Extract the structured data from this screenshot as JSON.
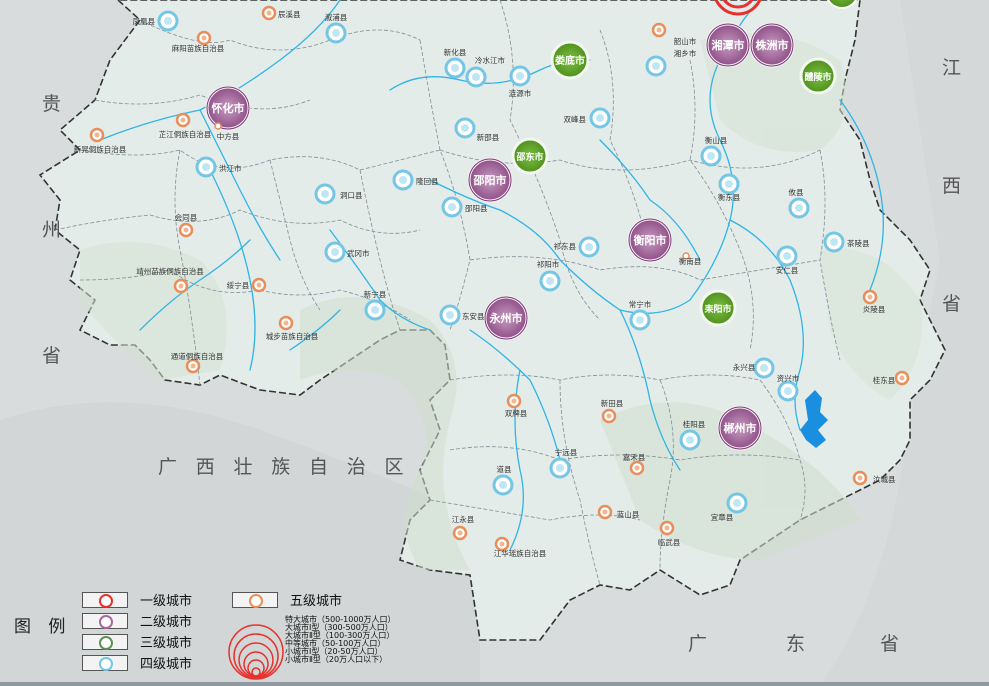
{
  "colors": {
    "land_base": "#e6edec",
    "land_green": "#d7e4d6",
    "outside": "#d9dcdc",
    "river": "#2fb4e6",
    "lake": "#1a8fe0",
    "border_county": "#8a9aa0",
    "border_province": "#333333",
    "level1": "#e8312c",
    "level2": "#a8679e",
    "level3": "#6aaa2c",
    "level4": "#74c6e4",
    "level5": "#e88e5a"
  },
  "regions": {
    "guizhou": [
      "贵",
      "州",
      "省"
    ],
    "guangxi": "广 西 壮 族 自 治 区",
    "jiangxi": [
      "江",
      "西",
      "省"
    ],
    "guangdong": [
      "广",
      "东",
      "省"
    ]
  },
  "cities": {
    "level2": [
      "怀化市",
      "邵阳市",
      "湘潭市",
      "株洲市",
      "衡阳市",
      "永州市",
      "郴州市"
    ],
    "level3": [
      "娄底市",
      "邵东市",
      "醴陵市",
      "耒阳市"
    ],
    "level4": [
      "凤凰县",
      "溆浦县",
      "新化县",
      "冷水江市",
      "涟源市",
      "湘乡市",
      "双峰县",
      "新邵县",
      "洪江市",
      "洞口县",
      "隆回县",
      "邵阳县",
      "衡山县",
      "衡东县",
      "攸县",
      "茶陵县",
      "武冈市",
      "新宁县",
      "祁阳市",
      "东安县",
      "祁东县",
      "常宁市",
      "安仁县",
      "永兴县",
      "资兴市",
      "桂阳县",
      "宁远县",
      "道县",
      "宜章县"
    ],
    "level5": [
      "辰溪县",
      "麻阳苗族自治县",
      "新晃侗族自治县",
      "芷江侗族自治县",
      "中方县",
      "会同县",
      "靖州苗族侗族自治县",
      "绥宁县",
      "城步苗族自治县",
      "通道侗族自治县",
      "韶山市",
      "衡南县",
      "炎陵县",
      "桂东县",
      "双牌县",
      "新田县",
      "嘉禾县",
      "临武县",
      "蓝山县",
      "江永县",
      "江华瑶族自治县",
      "汝城县"
    ]
  },
  "legend": {
    "title": "图 例",
    "items": [
      "一级城市",
      "二级城市",
      "三级城市",
      "四级城市",
      "五级城市"
    ],
    "size_items": [
      "特大城市（500-1000万人口）",
      "大城市Ⅰ型（300-500万人口）",
      "大城市Ⅱ型（100-300万人口）",
      "中等城市（50-100万人口）",
      "小城市Ⅰ型（20-50万人口）",
      "小城市Ⅱ型（20万人口以下）"
    ]
  }
}
